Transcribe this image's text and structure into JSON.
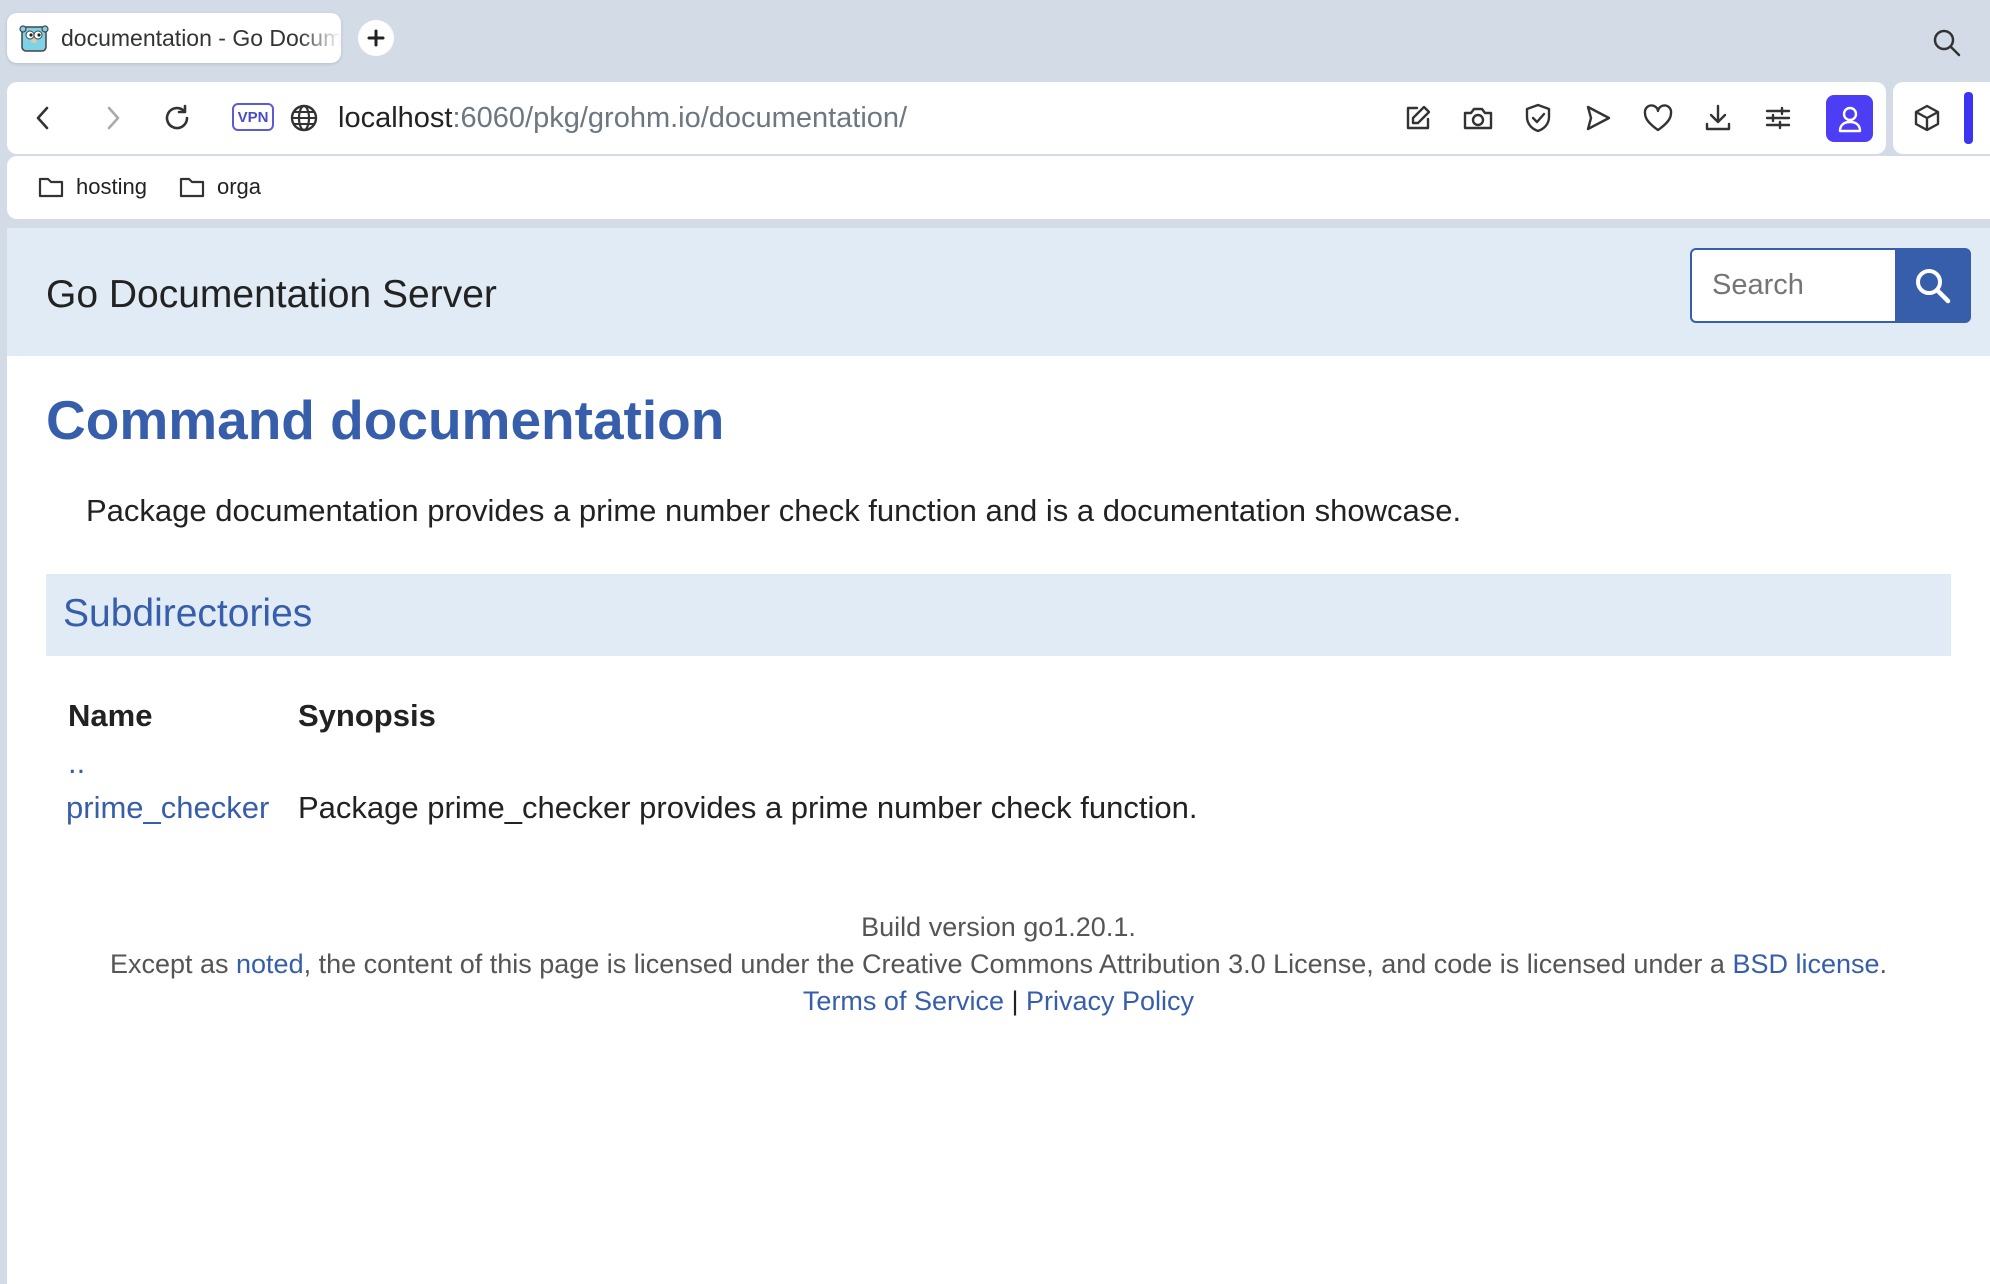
{
  "browser": {
    "tab_title": "documentation - Go Documentation Server",
    "url_host": "localhost",
    "url_rest": ":6060/pkg/grohm.io/documentation/",
    "vpn_label": "VPN",
    "bookmarks": [
      {
        "label": "hosting"
      },
      {
        "label": "orga"
      }
    ],
    "accent_color": "#4d3df5"
  },
  "page": {
    "site_title": "Go Documentation Server",
    "search_placeholder": "Search",
    "heading": "Command documentation",
    "synopsis": "Package documentation provides a prime number check function and is a documentation showcase.",
    "subdirectories_title": "Subdirectories",
    "table": {
      "headers": [
        "Name",
        "Synopsis"
      ],
      "rows": [
        {
          "name": "..",
          "synopsis": ""
        },
        {
          "name": "prime_checker",
          "synopsis": "Package prime_checker provides a prime number check function."
        }
      ]
    },
    "footer": {
      "build": "Build version go1.20.1.",
      "license_prefix": "Except as ",
      "noted_link": "noted",
      "license_middle": ", the content of this page is licensed under the Creative Commons Attribution 3.0 License, and code is licensed under a ",
      "bsd_link": "BSD license",
      "license_suffix": ".",
      "terms_link": "Terms of Service",
      "separator": " | ",
      "privacy_link": "Privacy Policy"
    },
    "link_color": "#375eab",
    "header_bg": "#e0ebf5"
  }
}
